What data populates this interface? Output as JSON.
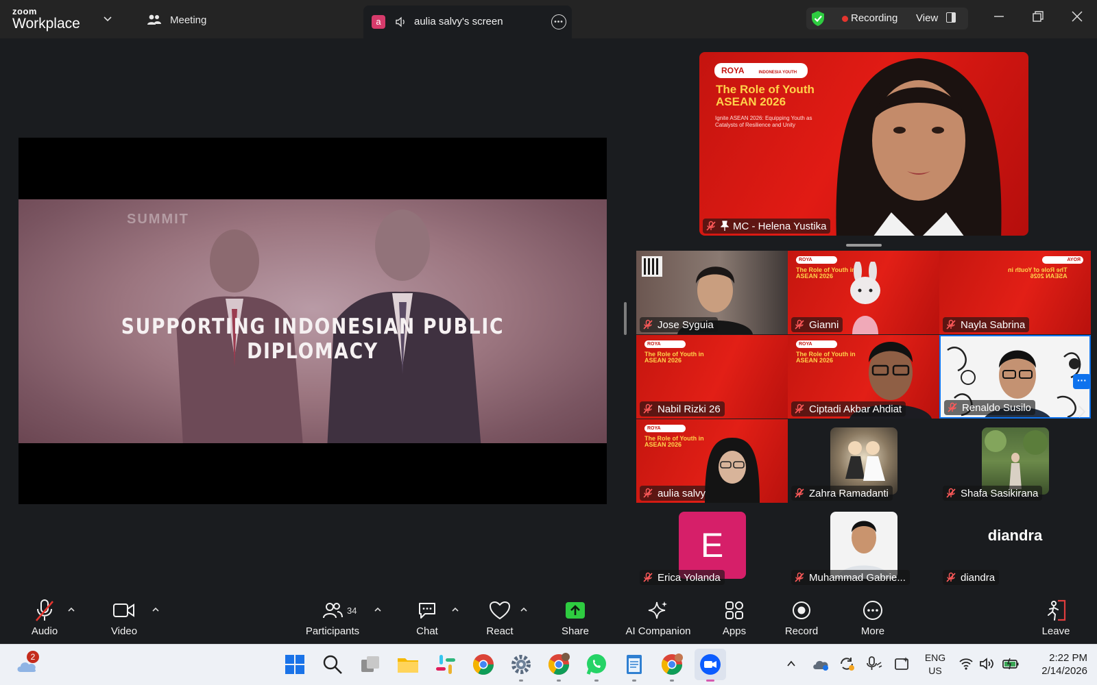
{
  "titlebar": {
    "brand_top": "zoom",
    "brand_bottom": "Workplace",
    "meeting_label": "Meeting",
    "share_avatar_letter": "a",
    "share_title": "aulia salvy's screen",
    "recording_label": "Recording",
    "view_label": "View"
  },
  "screen_share": {
    "caption": "SUPPORTING INDONESIAN PUBLIC DIPLOMACY",
    "backdrop_text": "SUMMIT"
  },
  "speaker": {
    "name": "MC - Helena Yustika",
    "slide_badge": "ROYA",
    "slide_badge2": "INDONESIA YOUTH FOUNDATION",
    "slide_title_line1": "The Role of Youth",
    "slide_title_line2": "ASEAN 2026",
    "slide_sub": "Ignite ASEAN 2026: Equipping Youth as Catalysts of Resilience and Unity"
  },
  "participants": [
    {
      "name": "Jose Syguia"
    },
    {
      "name": "Gianni"
    },
    {
      "name": "Nayla Sabrina"
    },
    {
      "name": "Nabil Rizki 26"
    },
    {
      "name": "Ciptadi Akbar Ahdiat"
    },
    {
      "name": "Renaldo Susilo"
    },
    {
      "name": "aulia salvy"
    },
    {
      "name": "Zahra Ramadanti"
    },
    {
      "name": "Shafa Sasikirana"
    },
    {
      "name": "Erica Yolanda",
      "avatar_letter": "E"
    },
    {
      "name": "Muhammad Gabrie..."
    },
    {
      "name": "diandra",
      "display_text": "diandra"
    }
  ],
  "mini_slide": {
    "badge": "ROYA",
    "title_line1": "The Role of Youth in",
    "title_line2": "ASEAN 2026",
    "sub": "Ignite ASEAN 2026: Equipping Youth as Catalysts of Resilience and Unity"
  },
  "toolbar": {
    "audio": "Audio",
    "video": "Video",
    "participants": "Participants",
    "participant_count": "34",
    "chat": "Chat",
    "react": "React",
    "share": "Share",
    "ai_companion": "AI Companion",
    "apps": "Apps",
    "record": "Record",
    "more": "More",
    "leave": "Leave"
  },
  "taskbar": {
    "weather_badge": "2",
    "lang_line1": "ENG",
    "lang_line2": "US",
    "time": "2:22 PM",
    "date": "2/14/2026"
  },
  "colors": {
    "zoom_blue": "#0e72ed",
    "share_green": "#2ecc40",
    "record_red": "#e5352e",
    "leave_red": "#e03d3d",
    "slide_red": "#e11b14"
  }
}
